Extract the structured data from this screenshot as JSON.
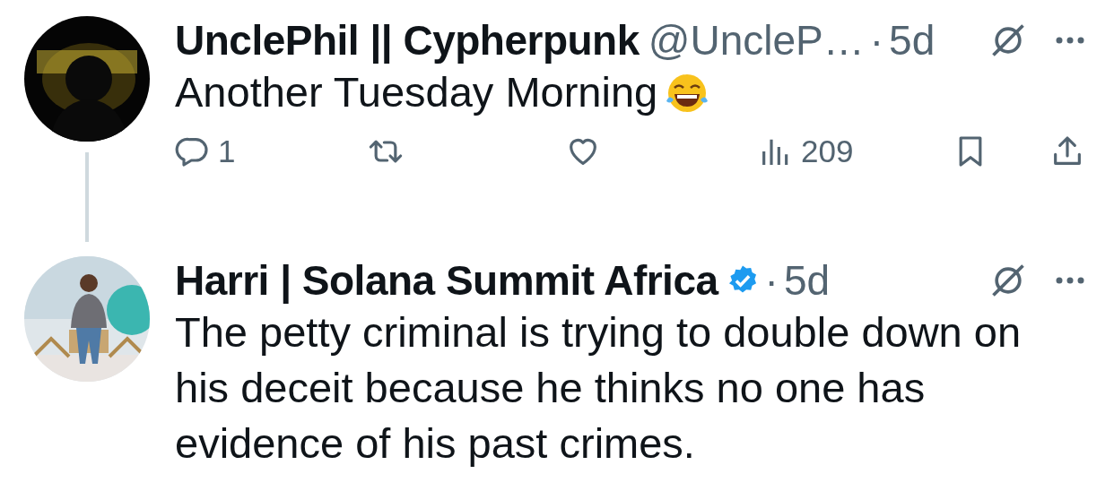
{
  "tweets": [
    {
      "author": "UnclePhil || Cypherpunk",
      "handle": "@UncleP…",
      "separator": "·",
      "time": "5d",
      "text": "Another Tuesday Morning",
      "emoji": true,
      "thread_line": true,
      "actions": [
        {
          "kind": "reply",
          "count": "1"
        },
        {
          "kind": "repost"
        },
        {
          "kind": "like"
        },
        {
          "kind": "views",
          "count": "209"
        },
        {
          "kind": "bookmark"
        },
        {
          "kind": "share"
        }
      ]
    },
    {
      "author": "Harri | Solana Summit Africa",
      "separator": "·",
      "time": "5d",
      "verified": true,
      "text": "The petty criminal is trying to double down on his deceit because he thinks no one has evidence of his past crimes."
    }
  ]
}
